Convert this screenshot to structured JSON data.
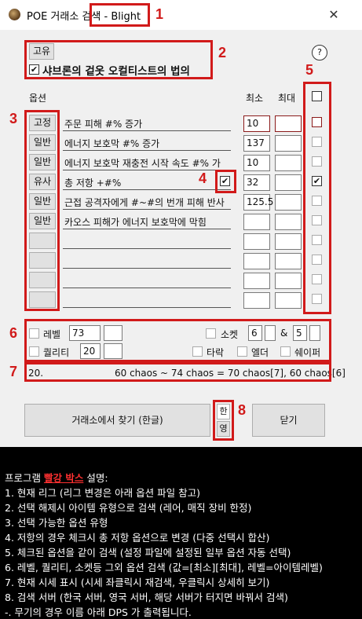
{
  "window": {
    "title": "POE 거래소 검색",
    "league": " - Blight",
    "close_glyph": "✕"
  },
  "item": {
    "rarity_button": "고유",
    "name": "샤브론의 겉옷 오컬티스트의 법의",
    "name_checked": true,
    "help_label": "?"
  },
  "options_header": {
    "options": "옵션",
    "min": "최소",
    "max": "최대"
  },
  "options": [
    {
      "type": "고정",
      "text": "주문 피해 #% 증가",
      "min": "10",
      "max": "",
      "checked": false
    },
    {
      "type": "일반",
      "text": "에너지 보호막 #% 증가",
      "min": "137",
      "max": "",
      "checked": false
    },
    {
      "type": "일반",
      "text": "에너지 보호막 재충전 시작 속도 #% 가",
      "min": "10",
      "max": "",
      "checked": false
    },
    {
      "type": "유사",
      "text": "총 저항 +#%",
      "min": "32",
      "max": "",
      "checked": true
    },
    {
      "type": "일반",
      "text": "근접 공격자에게 #~#의 번개 피해 반사",
      "min": "125.5",
      "max": "",
      "checked": false
    },
    {
      "type": "일반",
      "text": "카오스 피해가 에너지 보호막에 막힘",
      "min": "",
      "max": "",
      "checked": false
    },
    {
      "type": "",
      "text": "",
      "min": "",
      "max": "",
      "checked": false
    },
    {
      "type": "",
      "text": "",
      "min": "",
      "max": "",
      "checked": false
    },
    {
      "type": "",
      "text": "",
      "min": "",
      "max": "",
      "checked": false
    },
    {
      "type": "",
      "text": "",
      "min": "",
      "max": "",
      "checked": false
    }
  ],
  "similar_check_checked": true,
  "extra": {
    "level_label": "레벨",
    "level_min": "73",
    "level_max": "",
    "quality_label": "퀄리티",
    "quality_min": "20",
    "quality_max": "",
    "sockets_label": "소켓",
    "sockets_min": "6",
    "sockets_max": "",
    "links_label": "&",
    "links_min": "5",
    "links_max": "",
    "shaper_label": "쉐이퍼",
    "elder_label": "엘더",
    "corrupted_label": "타락"
  },
  "price": {
    "count": "20.",
    "summary": "60 chaos ~ 74 chaos = 70 chaos[7], 60 chaos[6]"
  },
  "actions": {
    "search_button": "거래소에서 찾기 (한글)",
    "lang_ko": "한",
    "lang_en": "영",
    "close_button": "닫기"
  },
  "annotations": [
    "1",
    "2",
    "3",
    "4",
    "5",
    "6",
    "7",
    "8"
  ],
  "legend": {
    "intro_prefix": "프로그램 ",
    "intro_highlight": "빨강 박스",
    "intro_suffix": " 설명:",
    "lines": [
      "1. 현재 리그 (리그 변경은 아래 옵션 파일 참고)",
      "2. 선택 해제시 아이템 유형으로 검색 (레어, 매직 장비 한정)",
      "3. 선택 가능한 옵션 유형",
      "4. 저항의 경우 체크시 총 저항 옵션으로 변경 (다중 선택시 합산)",
      "5. 체크된 옵션을 같이 검색 (설정 파일에 설정된 일부 옵션 자동 선택)",
      "6. 레벨, 퀄리티, 소켓등 그외 옵션 검색 (값=[최소][최대], 레벨=아이템레벨)",
      "7. 현재 시세 표시 (시세 좌클릭시 재검색, 우클릭시 상세히 보기)",
      "8. 검색 서버 (한국 서버, 영국 서버, 해당 서버가 터지면 바꿔서 검색)",
      "-. 무기의 경우 이름 아래 DPS 가 출력됩니다."
    ]
  },
  "colors": {
    "annotation": "#d11a1a",
    "highlight": "#ff3030"
  }
}
